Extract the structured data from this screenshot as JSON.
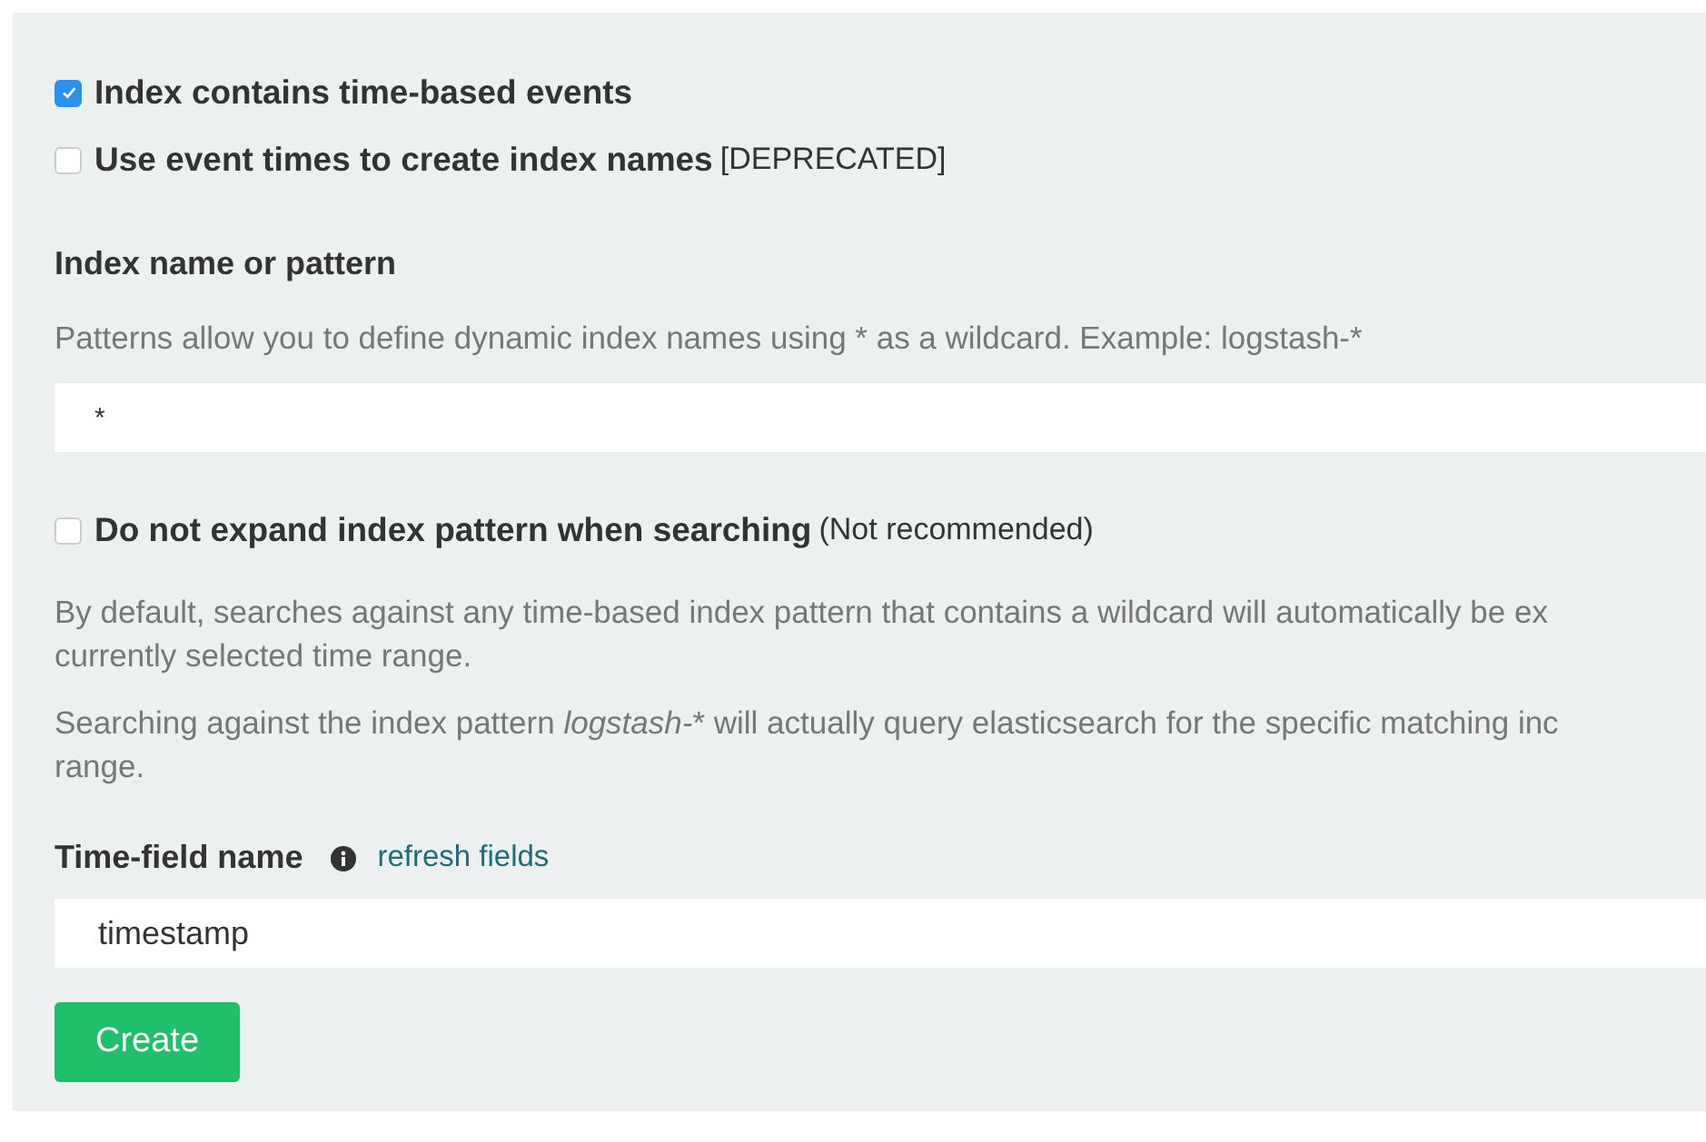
{
  "options_top": [
    {
      "label": "Index contains time-based events",
      "checked": true
    },
    {
      "label": "Use event times to create index names",
      "note": "[DEPRECATED]",
      "checked": false
    }
  ],
  "index_pattern": {
    "label": "Index name or pattern",
    "help": "Patterns allow you to define dynamic index names using * as a wildcard. Example: logstash-*",
    "value": "*"
  },
  "expand_option": {
    "label": "Do not expand index pattern when searching",
    "note": "(Not recommended)",
    "checked": false
  },
  "explanation_1": [
    "By default, searches against any time-based index pattern that contains a wildcard will automatically be ex",
    "currently selected time range."
  ],
  "explanation_2": {
    "before": "Searching against the index pattern ",
    "italic": "logstash-",
    "after": "* will actually query elasticsearch for the specific matching inc",
    "line_2": "range."
  },
  "time_field": {
    "label": "Time-field name",
    "link": "refresh fields",
    "value": "timestamp"
  },
  "create_button": "Create"
}
